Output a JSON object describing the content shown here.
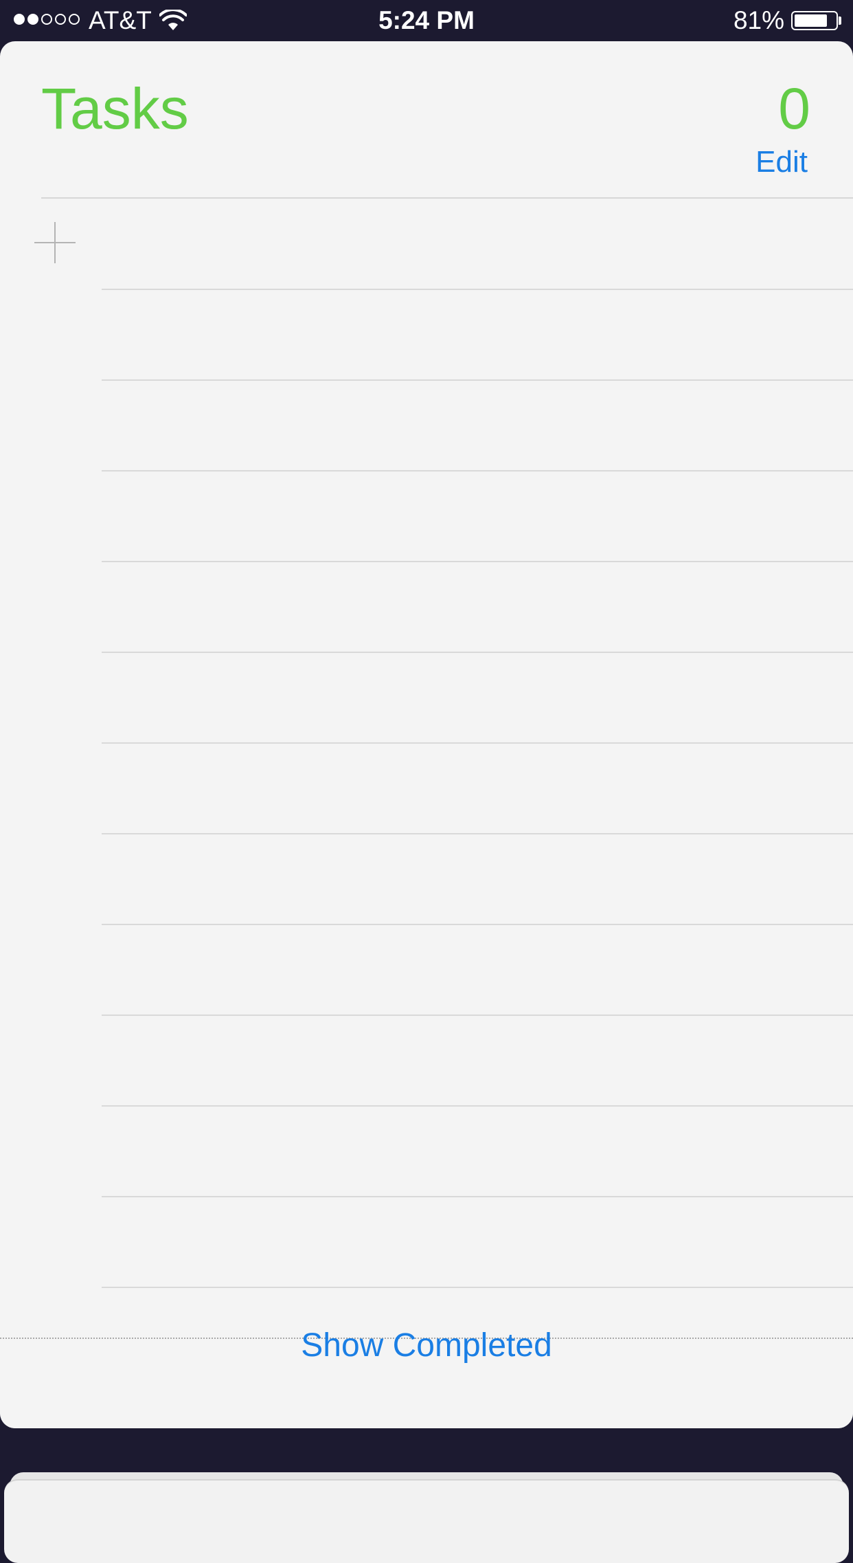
{
  "status_bar": {
    "carrier": "AT&T",
    "time": "5:24 PM",
    "battery_percent": "81%",
    "battery_level": 0.81,
    "signal_bars_filled": 2,
    "signal_bars_total": 5
  },
  "list": {
    "title": "Tasks",
    "count": "0",
    "edit_label": "Edit",
    "show_completed_label": "Show Completed",
    "empty_rows": 12
  },
  "colors": {
    "title_green": "#62cc46",
    "link_blue": "#1a7ee4",
    "background_dark": "#1c1a30",
    "paper": "#f4f4f4"
  },
  "icons": {
    "add": "plus-icon",
    "wifi": "wifi-icon",
    "battery": "battery-icon"
  }
}
